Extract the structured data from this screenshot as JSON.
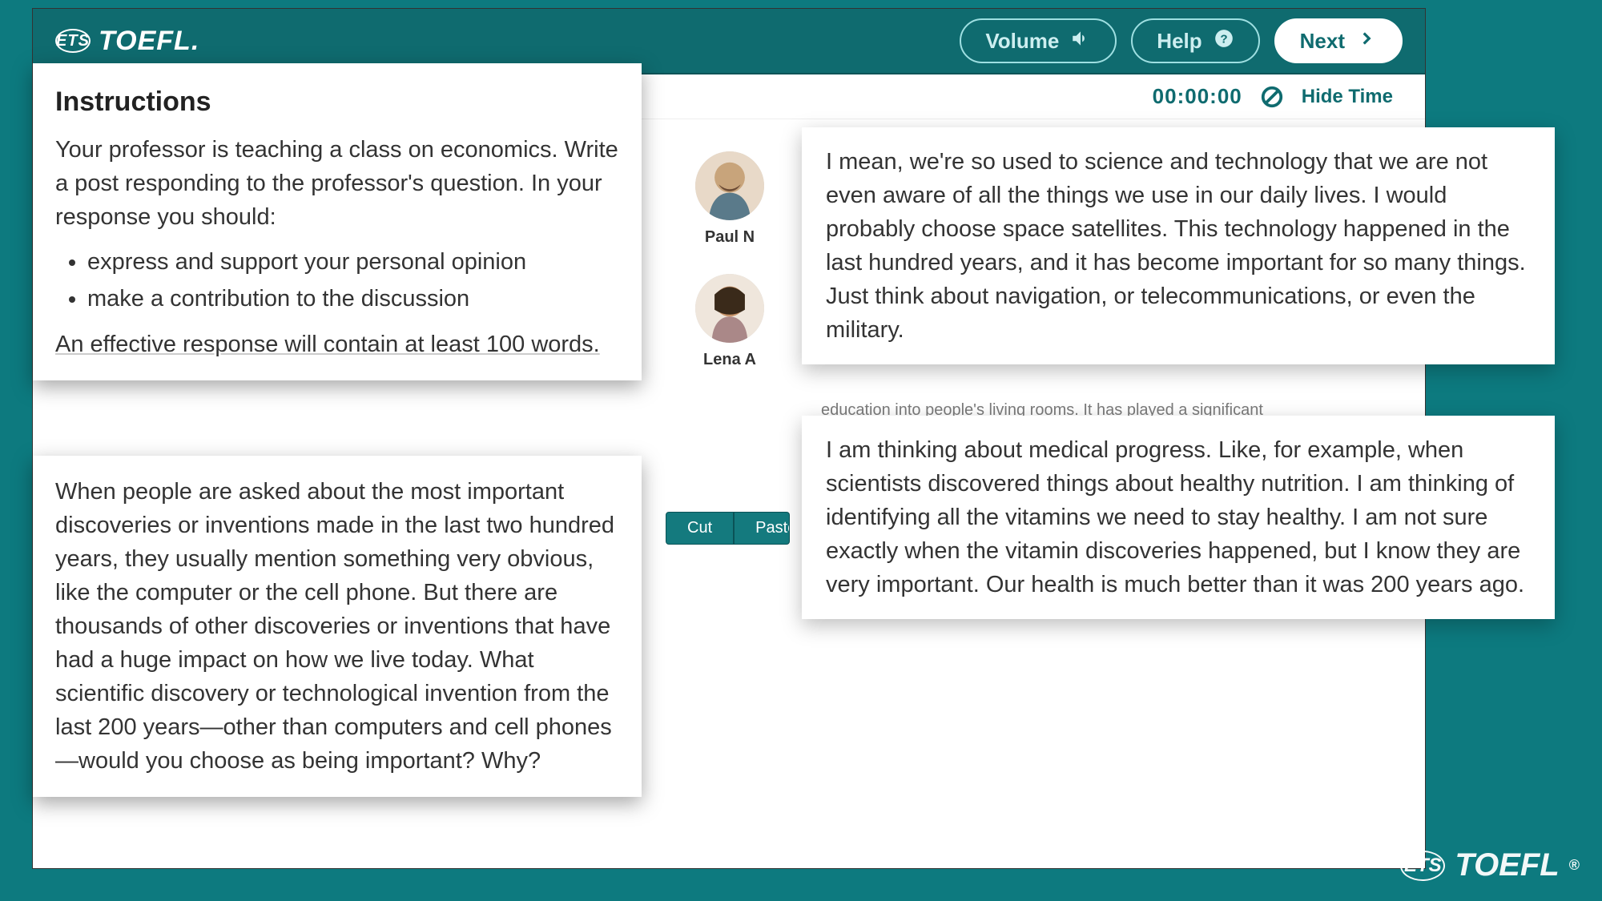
{
  "brand": {
    "ets": "ETS",
    "name": "TOEFL."
  },
  "topbar": {
    "volume": "Volume",
    "help": "Help",
    "next": "Next"
  },
  "subbar": {
    "timer": "00:00:00",
    "hide_time": "Hide Time"
  },
  "instructions": {
    "title": "Instructions",
    "p1": "Your professor is teaching a class on economics. Write a post responding to the professor's question. In your response you should:",
    "b1": "express and support your personal opinion",
    "b2": "make a contribution to the discussion",
    "p2": "An effective response will contain at least 100 words."
  },
  "prompt": {
    "text": "When people are asked about the most important discoveries or inventions made in the last two hundred years, they usually mention something very obvious, like the computer or the cell phone. But there are thousands of other discoveries or inventions that have had a huge impact on how we live today. What scientific discovery or technological invention from the last 200 years—other than computers and cell phones—would you choose as being important? Why?"
  },
  "avatars": {
    "paul": "Paul N",
    "lena": "Lena A"
  },
  "responses": {
    "paul": "I mean, we're so used to science and technology that we are not even aware of all the things we use in our daily lives. I would probably choose space satellites. This technology happened in the last hundred years, and it has become important for so many things. Just think about navigation, or telecommunications, or even the military.",
    "truncated": "education into people's living rooms. It has played a significant",
    "lena": "I am thinking about medical progress. Like, for example, when scientists discovered things about healthy nutrition. I am thinking of identifying all the vitamins we need to stay healthy. I am not sure exactly when the vitamin discoveries happened, but I know they are very important. Our health is much better than it was 200 years ago."
  },
  "edit": {
    "cut": "Cut",
    "paste": "Paste"
  },
  "watermark": {
    "ets": "ETS",
    "name": "TOEFL",
    "reg": "®"
  }
}
